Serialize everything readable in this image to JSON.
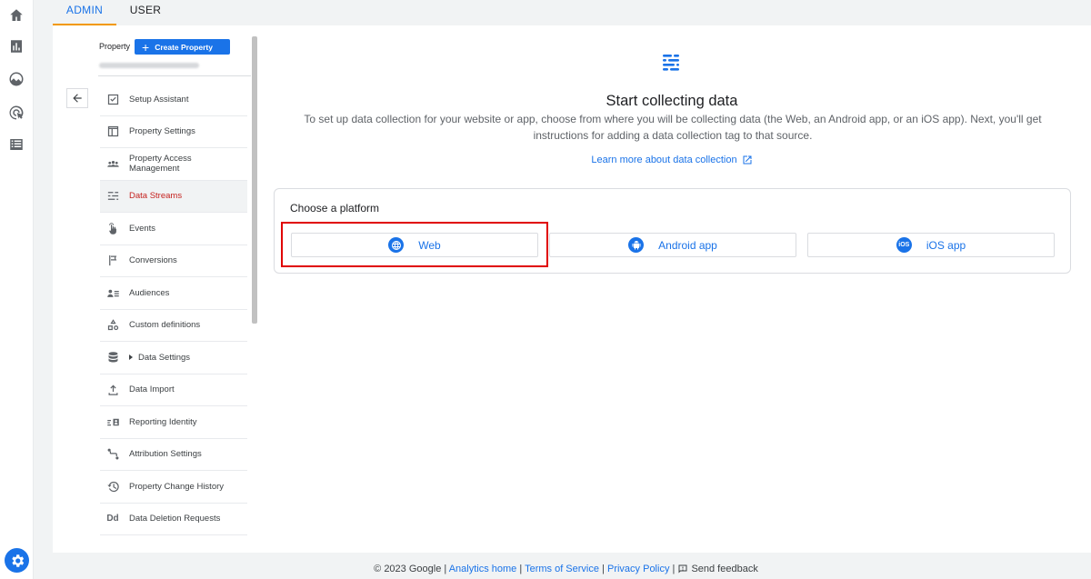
{
  "tabs": {
    "admin": "ADMIN",
    "user": "USER"
  },
  "sidebar": {
    "property_label": "Property",
    "create_property": "Create Property",
    "items": [
      {
        "label": "Setup Assistant",
        "icon": "checkbox-icon"
      },
      {
        "label": "Property Settings",
        "icon": "window-icon"
      },
      {
        "label": "Property Access Management",
        "icon": "people-icon"
      },
      {
        "label": "Data Streams",
        "icon": "streams-icon",
        "active": true
      },
      {
        "label": "Events",
        "icon": "touch-icon"
      },
      {
        "label": "Conversions",
        "icon": "flag-icon"
      },
      {
        "label": "Audiences",
        "icon": "audience-icon"
      },
      {
        "label": "Custom definitions",
        "icon": "shapes-icon"
      },
      {
        "label": "Data Settings",
        "icon": "database-icon"
      },
      {
        "label": "Data Import",
        "icon": "upload-icon"
      },
      {
        "label": "Reporting Identity",
        "icon": "identity-icon"
      },
      {
        "label": "Attribution Settings",
        "icon": "route-icon"
      },
      {
        "label": "Property Change History",
        "icon": "history-icon"
      },
      {
        "label": "Data Deletion Requests",
        "icon": "dd-icon"
      }
    ]
  },
  "main": {
    "title": "Start collecting data",
    "description": "To set up data collection for your website or app, choose from where you will be collecting data (the Web, an Android app, or an iOS app). Next, you'll get instructions for adding a data collection tag to that source.",
    "learn_more": "Learn more about data collection",
    "choose_platform": "Choose a platform",
    "platforms": {
      "web": "Web",
      "android": "Android app",
      "ios": "iOS app",
      "ios_badge": "iOS"
    }
  },
  "footer": {
    "copyright": "© 2023 Google",
    "analytics_home": "Analytics home",
    "terms": "Terms of Service",
    "privacy": "Privacy Policy",
    "feedback": "Send feedback"
  },
  "colors": {
    "accent": "#1a73e8",
    "active_text": "#c5221f",
    "highlight": "#e00000",
    "tab_underline": "#f29900"
  }
}
